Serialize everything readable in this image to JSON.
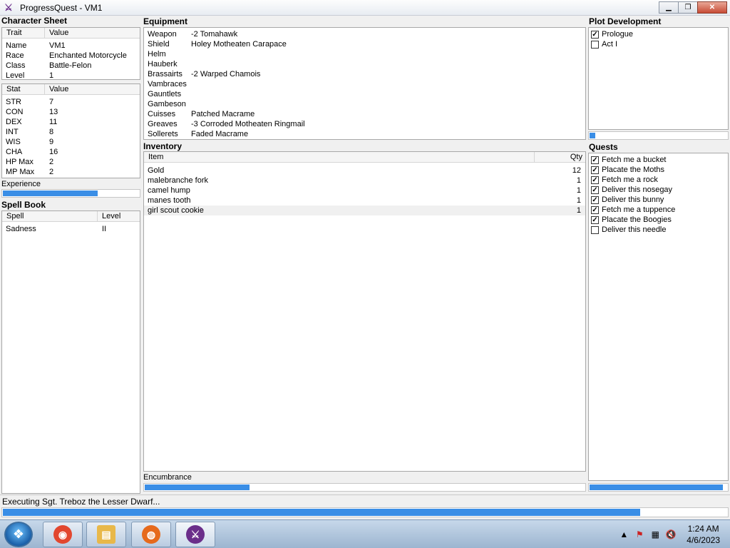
{
  "window": {
    "title": "ProgressQuest - VM1",
    "minimize": "▁",
    "maximize": "❐",
    "close": "✕"
  },
  "character_sheet": {
    "title": "Character Sheet",
    "trait_header": [
      "Trait",
      "Value"
    ],
    "traits": [
      {
        "k": "Name",
        "v": "VM1"
      },
      {
        "k": "Race",
        "v": "Enchanted Motorcycle"
      },
      {
        "k": "Class",
        "v": "Battle-Felon"
      },
      {
        "k": "Level",
        "v": "1"
      }
    ],
    "stat_header": [
      "Stat",
      "Value"
    ],
    "stats": [
      {
        "k": "STR",
        "v": "7"
      },
      {
        "k": "CON",
        "v": "13"
      },
      {
        "k": "DEX",
        "v": "11"
      },
      {
        "k": "INT",
        "v": "8"
      },
      {
        "k": "WIS",
        "v": "9"
      },
      {
        "k": "CHA",
        "v": "16"
      },
      {
        "k": "HP Max",
        "v": "2"
      },
      {
        "k": "MP Max",
        "v": "2"
      }
    ],
    "experience_label": "Experience",
    "experience_progress": 0.7
  },
  "spell_book": {
    "title": "Spell Book",
    "header": [
      "Spell",
      "Level"
    ],
    "spells": [
      {
        "k": "Sadness",
        "v": "II"
      }
    ]
  },
  "equipment": {
    "title": "Equipment",
    "items": [
      {
        "k": "Weapon",
        "v": "-2 Tomahawk"
      },
      {
        "k": "Shield",
        "v": "Holey Motheaten Carapace"
      },
      {
        "k": "Helm",
        "v": ""
      },
      {
        "k": "Hauberk",
        "v": ""
      },
      {
        "k": "Brassairts",
        "v": "-2 Warped Chamois"
      },
      {
        "k": "Vambraces",
        "v": ""
      },
      {
        "k": "Gauntlets",
        "v": ""
      },
      {
        "k": "Gambeson",
        "v": ""
      },
      {
        "k": "Cuisses",
        "v": "Patched Macrame"
      },
      {
        "k": "Greaves",
        "v": "-3 Corroded Motheaten Ringmail"
      },
      {
        "k": "Sollerets",
        "v": "Faded Macrame"
      }
    ]
  },
  "inventory": {
    "title": "Inventory",
    "header": [
      "Item",
      "Qty"
    ],
    "items": [
      {
        "k": "Gold",
        "v": "12"
      },
      {
        "k": "malebranche fork",
        "v": "1"
      },
      {
        "k": "camel hump",
        "v": "1"
      },
      {
        "k": "manes tooth",
        "v": "1"
      },
      {
        "k": "girl scout cookie",
        "v": "1"
      }
    ],
    "encumbrance_label": "Encumbrance",
    "encumbrance_progress": 0.24
  },
  "plot": {
    "title": "Plot Development",
    "acts": [
      {
        "label": "Prologue",
        "checked": true
      },
      {
        "label": "Act I",
        "checked": false
      }
    ],
    "progress": 0.05
  },
  "quests": {
    "title": "Quests",
    "items": [
      {
        "label": "Fetch me a bucket",
        "checked": true
      },
      {
        "label": "Placate the Moths",
        "checked": true
      },
      {
        "label": "Fetch me a rock",
        "checked": true
      },
      {
        "label": "Deliver this nosegay",
        "checked": true
      },
      {
        "label": "Deliver this bunny",
        "checked": true
      },
      {
        "label": "Fetch me a tuppence",
        "checked": true
      },
      {
        "label": "Placate the Boogies",
        "checked": true
      },
      {
        "label": "Deliver this needle",
        "checked": false
      }
    ],
    "progress": 0.97
  },
  "status": {
    "text": "Executing Sgt. Treboz the Lesser Dwarf...",
    "progress": 0.88
  },
  "taskbar": {
    "apps": [
      {
        "name": "chrome-icon",
        "color": "#e2472f"
      },
      {
        "name": "folder-icon",
        "color": "#e8b84a"
      },
      {
        "name": "firefox-icon",
        "color": "#e66a1d"
      },
      {
        "name": "progressquest-icon",
        "color": "#6b2e8a"
      }
    ],
    "time": "1:24 AM",
    "date": "4/6/2023"
  },
  "colors": {
    "progress": "#3a8ee6",
    "accent": "#3a8ee6"
  }
}
